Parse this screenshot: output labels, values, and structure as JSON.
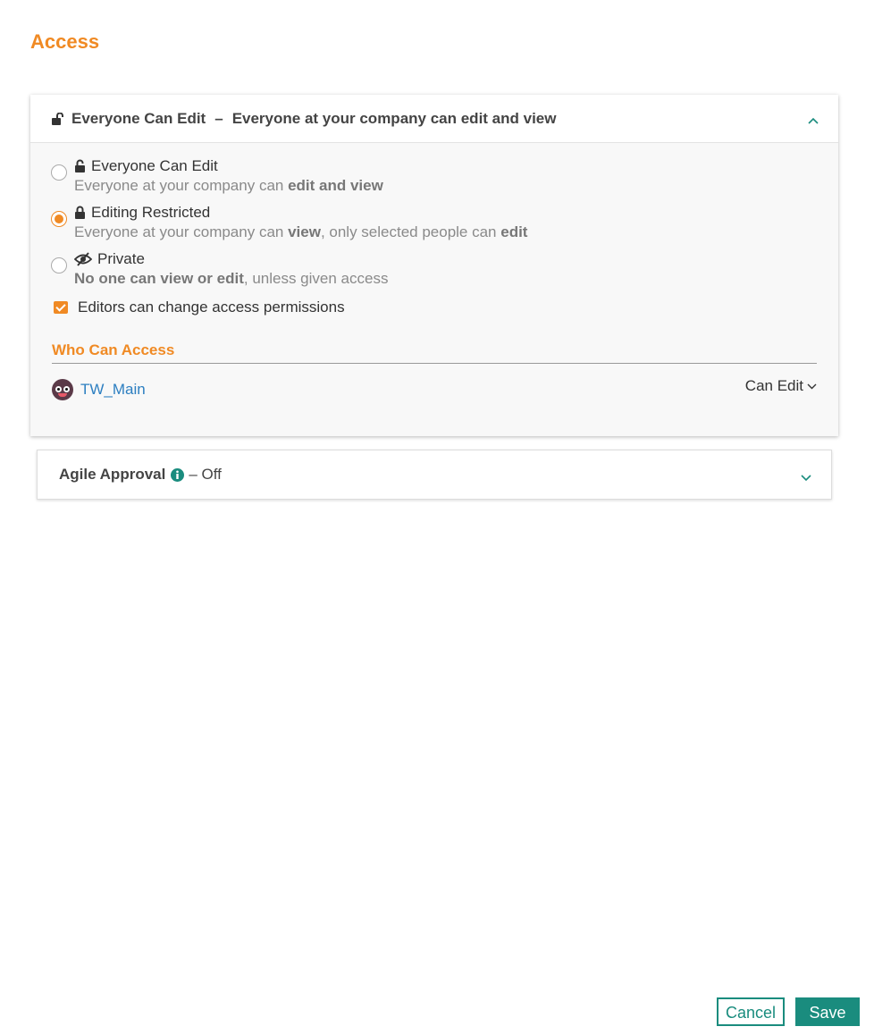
{
  "page": {
    "title": "Access"
  },
  "access_panel": {
    "header_mode": "Everyone Can Edit",
    "header_separator": "–",
    "header_description": "Everyone at your company can edit and view",
    "options": [
      {
        "title": "Everyone Can Edit",
        "icon": "unlock-icon",
        "desc_parts": [
          "Everyone at your company can ",
          "edit and view",
          ""
        ],
        "selected": false
      },
      {
        "title": "Editing Restricted",
        "icon": "lock-icon",
        "desc_parts": [
          "Everyone at your company can ",
          "view",
          ", only selected people can ",
          "edit"
        ],
        "selected": true
      },
      {
        "title": "Private",
        "icon": "eye-slash-icon",
        "desc_parts": [
          "No one can view or edit",
          ", unless given access"
        ],
        "selected": false
      }
    ],
    "editors_checkbox": {
      "label": "Editors can change access permissions",
      "checked": true
    },
    "who_can_access": {
      "title": "Who Can Access",
      "users": [
        {
          "name": "TW_Main",
          "permission": "Can Edit"
        }
      ]
    }
  },
  "agile_panel": {
    "title": "Agile Approval",
    "status": "– Off"
  },
  "footer": {
    "cancel_label": "Cancel",
    "save_label": "Save"
  },
  "colors": {
    "accent_orange": "#f08a24",
    "teal": "#1a8c7e",
    "link_blue": "#2d7fc1"
  }
}
